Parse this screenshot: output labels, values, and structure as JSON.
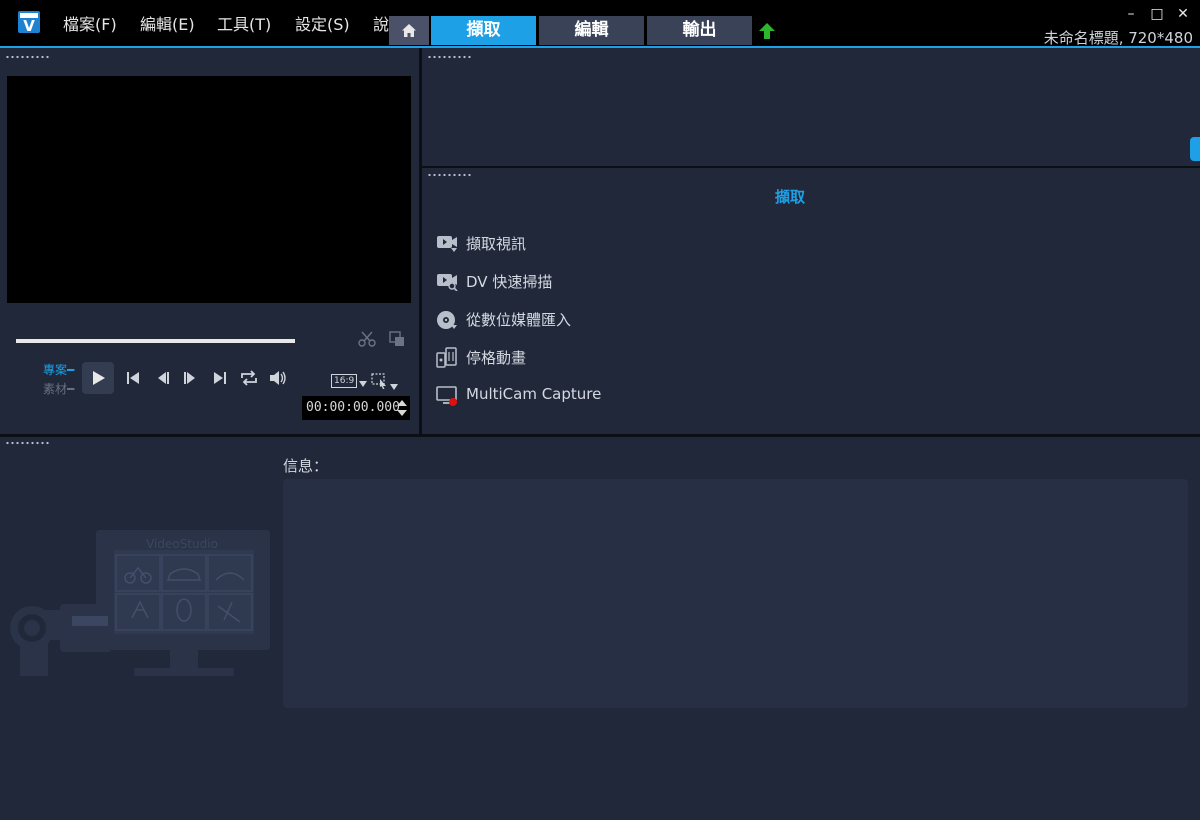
{
  "menu": [
    "檔案(F)",
    "編輯(E)",
    "工具(T)",
    "設定(S)",
    "說明(H)"
  ],
  "tabs": [
    {
      "label": "擷取",
      "active": true
    },
    {
      "label": "編輯",
      "active": false
    },
    {
      "label": "輸出",
      "active": false
    }
  ],
  "project_title": "未命名標題, 720*480",
  "window_controls": {
    "minimize": "–",
    "maximize": "□",
    "close": "✕"
  },
  "preview": {
    "mode_project": "專案",
    "mode_clip": "素材",
    "timecode": "00:00:00.000",
    "aspect_ratio": "16:9"
  },
  "capture": {
    "title": "擷取",
    "items": [
      {
        "label": "擷取視訊",
        "icon": "video-capture-icon"
      },
      {
        "label": "DV 快速掃描",
        "icon": "dv-scan-icon"
      },
      {
        "label": "從數位媒體匯入",
        "icon": "disc-import-icon"
      },
      {
        "label": "停格動畫",
        "icon": "stop-motion-icon"
      },
      {
        "label": "MultiCam Capture",
        "icon": "multicam-icon"
      }
    ]
  },
  "info": {
    "label": "信息："
  },
  "illustration": {
    "brand": "VideoStudio"
  },
  "colors": {
    "accent": "#1ea0e6",
    "background": "#20283a",
    "upload": "#2db52d"
  }
}
